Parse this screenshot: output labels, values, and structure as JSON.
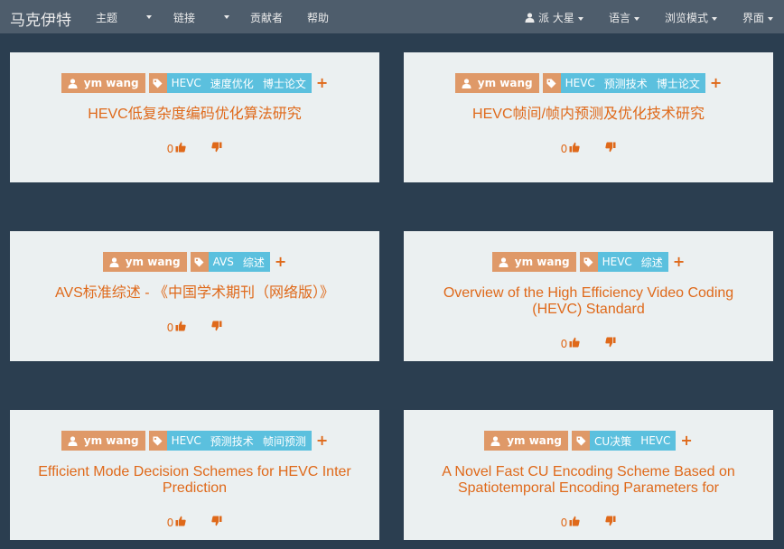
{
  "navbar": {
    "brand": "马克伊特",
    "theme": "主题",
    "links": "链接",
    "contributors": "贡献者",
    "help": "帮助",
    "user": "派 大星",
    "language": "语言",
    "browse_mode": "浏览模式",
    "interface": "界面"
  },
  "cards": [
    {
      "author": "ym wang",
      "tags": [
        "HEVC",
        "速度优化",
        "博士论文"
      ],
      "title": "HEVC低复杂度编码优化算法研究",
      "votes": "0"
    },
    {
      "author": "ym wang",
      "tags": [
        "HEVC",
        "预测技术",
        "博士论文"
      ],
      "title": "HEVC帧间/帧内预测及优化技术研究",
      "votes": "0"
    },
    {
      "author": "ym wang",
      "tags": [
        "AVS",
        "综述"
      ],
      "title": "AVS标准综述 - 《中国学术期刊（网络版）》",
      "votes": "0"
    },
    {
      "author": "ym wang",
      "tags": [
        "HEVC",
        "综述"
      ],
      "title": "Overview of the High Efficiency Video Coding (HEVC) Standard",
      "votes": "0"
    },
    {
      "author": "ym wang",
      "tags": [
        "HEVC",
        "预测技术",
        "帧间预测"
      ],
      "title": "Efficient Mode Decision Schemes for HEVC Inter Prediction",
      "votes": "0"
    },
    {
      "author": "ym wang",
      "tags": [
        "CU决策",
        "HEVC"
      ],
      "title": "A Novel Fast CU Encoding Scheme Based on Spatiotemporal Encoding Parameters for",
      "votes": "0"
    }
  ],
  "icons": {
    "user": "user-icon",
    "tag": "tag-icon",
    "add": "plus-icon",
    "up": "thumbs-up-icon",
    "down": "thumbs-down-icon"
  },
  "colors": {
    "background": "#2b3e50",
    "navbar": "#4e5d6c",
    "card": "#ebf0f1",
    "accent": "#df691a",
    "author_badge": "#df9968",
    "tag_badge": "#5bc0de"
  }
}
